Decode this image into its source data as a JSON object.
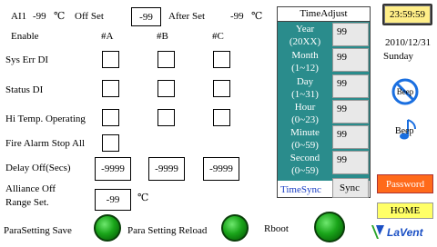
{
  "header": {
    "ai_label": "AI1",
    "ai_value": "-99",
    "ai_unit": "℃",
    "offset_label": "Off Set",
    "offset_value": "-99",
    "after_set_label": "After Set",
    "after_set_value": "-99",
    "after_set_unit": "℃"
  },
  "columns": {
    "enable": "Enable",
    "a": "#A",
    "b": "#B",
    "c": "#C"
  },
  "rows": {
    "sys_err": "Sys Err DI",
    "status": "Status DI",
    "hi_temp": "Hi Temp. Operating",
    "fire_alarm": "Fire Alarm Stop All",
    "delay_off": "Delay Off(Secs)",
    "alliance_off_1": "Alliance Off",
    "alliance_off_2": "Range Set."
  },
  "delay_values": [
    "-9999",
    "-9999",
    "-9999"
  ],
  "alliance": {
    "value": "-99",
    "unit": "℃"
  },
  "bottom": {
    "save_label": "ParaSetting Save",
    "reload_label": "Para Setting  Reload",
    "reboot_label": "Rboot"
  },
  "time_adjust": {
    "title": "TimeAdjust",
    "rows": [
      {
        "l1": "Year",
        "l2": "(20XX)",
        "value": "99"
      },
      {
        "l1": "Month",
        "l2": "(1~12)",
        "value": "99"
      },
      {
        "l1": "Day",
        "l2": "(1~31)",
        "value": "99"
      },
      {
        "l1": "Hour",
        "l2": "(0~23)",
        "value": "99"
      },
      {
        "l1": "Minute",
        "l2": "(0~59)",
        "value": "99"
      },
      {
        "l1": "Second",
        "l2": "(0~59)",
        "value": "99"
      }
    ],
    "timesync_label": "TimeSync",
    "sync_label": "Sync"
  },
  "side": {
    "clock": "23:59:59",
    "date": "2010/12/31",
    "weekday": "Sunday",
    "beep_off_label": "Beep",
    "beep_on_label": "Beep",
    "password_label": "Password",
    "home_label": "HOME",
    "logo_text": "LaVent"
  },
  "colors": {
    "panel": "#2a8c8c",
    "password_bg": "#ff6a1a",
    "home_bg": "#ffff66",
    "clock_bg": "#ffee88",
    "button_green": "#1aa51a"
  }
}
